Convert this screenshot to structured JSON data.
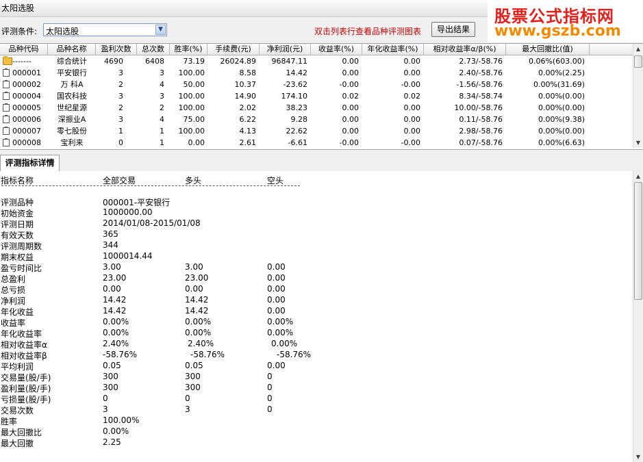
{
  "window": {
    "title": "太阳选股"
  },
  "watermark": {
    "line1": "股票公式指标网",
    "line2": "www.gszb.com"
  },
  "toolbar": {
    "condition_label": "评测条件:",
    "condition_value": "太阳选股",
    "hint": "双击列表行查看品种评测图表",
    "export_label": "导出结果"
  },
  "table": {
    "columns": [
      "品种代码",
      "品种名称",
      "盈利次数",
      "总次数",
      "胜率(%)",
      "手续费(元)",
      "净利润(元)",
      "收益率(%)",
      "年化收益率(%)",
      "相对收益率α/β(%)",
      "最大回撤比(值)"
    ],
    "rows": [
      {
        "icon": "folder-icon",
        "code": "-------",
        "name": "综合统计",
        "wins": "4690",
        "total": "6408",
        "winrate": "73.19",
        "fee": "26024.89",
        "profit": "96847.11",
        "ret": "0.00",
        "annual": "0.00",
        "relative": "2.73/-58.76",
        "drawdown": "0.06%(603.00)"
      },
      {
        "icon": "document-icon",
        "code": "000001",
        "name": "平安银行",
        "wins": "3",
        "total": "3",
        "winrate": "100.00",
        "fee": "8.58",
        "profit": "14.42",
        "ret": "0.00",
        "annual": "0.00",
        "relative": "2.40/-58.76",
        "drawdown": "0.00%(2.25)"
      },
      {
        "icon": "document-icon",
        "code": "000002",
        "name": "万  科A",
        "wins": "2",
        "total": "4",
        "winrate": "50.00",
        "fee": "10.37",
        "profit": "-23.62",
        "ret": "-0.00",
        "annual": "-0.00",
        "relative": "-1.56/-58.76",
        "drawdown": "0.00%(31.69)"
      },
      {
        "icon": "document-icon",
        "code": "000004",
        "name": "国农科技",
        "wins": "3",
        "total": "3",
        "winrate": "100.00",
        "fee": "14.90",
        "profit": "174.10",
        "ret": "0.02",
        "annual": "0.02",
        "relative": "8.34/-58.74",
        "drawdown": "0.00%(0.00)"
      },
      {
        "icon": "document-icon",
        "code": "000005",
        "name": "世纪星源",
        "wins": "2",
        "total": "2",
        "winrate": "100.00",
        "fee": "2.02",
        "profit": "38.23",
        "ret": "0.00",
        "annual": "0.00",
        "relative": "10.00/-58.76",
        "drawdown": "0.00%(0.00)"
      },
      {
        "icon": "document-icon",
        "code": "000006",
        "name": "深振业A",
        "wins": "3",
        "total": "4",
        "winrate": "75.00",
        "fee": "6.22",
        "profit": "9.28",
        "ret": "0.00",
        "annual": "0.00",
        "relative": "0.11/-58.76",
        "drawdown": "0.00%(9.38)"
      },
      {
        "icon": "document-icon",
        "code": "000007",
        "name": "零七股份",
        "wins": "1",
        "total": "1",
        "winrate": "100.00",
        "fee": "4.13",
        "profit": "22.62",
        "ret": "0.00",
        "annual": "0.00",
        "relative": "2.98/-58.76",
        "drawdown": "0.00%(0.00)"
      },
      {
        "icon": "document-icon",
        "code": "000008",
        "name": "宝利来",
        "wins": "0",
        "total": "1",
        "winrate": "0.00",
        "fee": "2.61",
        "profit": "-6.61",
        "ret": "-0.00",
        "annual": "-0.00",
        "relative": "0.07/-58.76",
        "drawdown": "0.00%(6.63)"
      }
    ]
  },
  "detail_tab": {
    "label": "评测指标详情"
  },
  "detail": {
    "headers": [
      "指标名称",
      "全部交易",
      "多头",
      "空头"
    ],
    "rows": [
      [
        "评测品种",
        "000001-平安银行",
        "",
        ""
      ],
      [
        "初始资金",
        "1000000.00",
        "",
        ""
      ],
      [
        "评测日期",
        "2014/01/08-2015/01/08",
        "",
        ""
      ],
      [
        "有效天数",
        "365",
        "",
        ""
      ],
      [
        "评测周期数",
        "344",
        "",
        ""
      ],
      [
        "期末权益",
        "1000014.44",
        "",
        ""
      ],
      [
        "盈亏时间比",
        "3.00",
        "3.00",
        "0.00"
      ],
      [
        "总盈利",
        "23.00",
        "23.00",
        "0.00"
      ],
      [
        "总亏损",
        "0.00",
        "0.00",
        "0.00"
      ],
      [
        "净利润",
        "14.42",
        "14.42",
        "0.00"
      ],
      [
        "年化收益",
        "14.42",
        "14.42",
        "0.00"
      ],
      [
        "收益率",
        "0.00%",
        "0.00%",
        "0.00%"
      ],
      [
        "年化收益率",
        "0.00%",
        "0.00%",
        "0.00%"
      ],
      [
        "相对收益率α",
        "2.40%",
        "2.40%",
        "0.00%"
      ],
      [
        "相对收益率β",
        "-58.76%",
        "-58.76%",
        "-58.76%"
      ],
      [
        "平均利润",
        "0.05",
        "0.05",
        "0.00"
      ],
      [
        "交易量(股/手)",
        "300",
        "300",
        "0"
      ],
      [
        "盈利量(股/手)",
        "300",
        "300",
        "0"
      ],
      [
        "亏损量(股/手)",
        "0",
        "0",
        "0"
      ],
      [
        "交易次数",
        "3",
        "3",
        "0"
      ],
      [
        "胜率",
        "100.00%",
        "",
        ""
      ],
      [
        "最大回撤比",
        "0.00%",
        "",
        ""
      ],
      [
        "最大回撤",
        "2.25",
        "",
        ""
      ]
    ]
  }
}
